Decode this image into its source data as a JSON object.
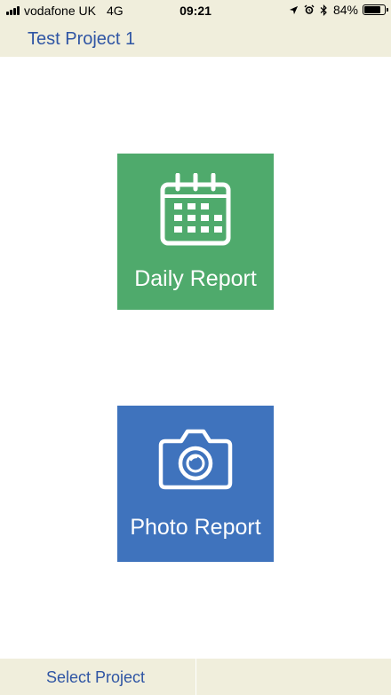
{
  "status_bar": {
    "carrier": "vodafone UK",
    "network": "4G",
    "time": "09:21",
    "battery_percent": "84%",
    "battery_level": 0.84,
    "icons": [
      "location-arrow-icon",
      "alarm-icon",
      "bluetooth-icon"
    ]
  },
  "nav": {
    "title": "Test Project 1"
  },
  "tiles": [
    {
      "label": "Daily Report",
      "icon": "calendar-icon",
      "color": "#4faa6c"
    },
    {
      "label": "Photo Report",
      "icon": "camera-icon",
      "color": "#3f73bd"
    }
  ],
  "tab_bar": {
    "items": [
      {
        "label": "Select Project"
      },
      {
        "label": ""
      }
    ]
  },
  "colors": {
    "bar_background": "#f0eedc",
    "accent_text": "#2f55a4"
  }
}
